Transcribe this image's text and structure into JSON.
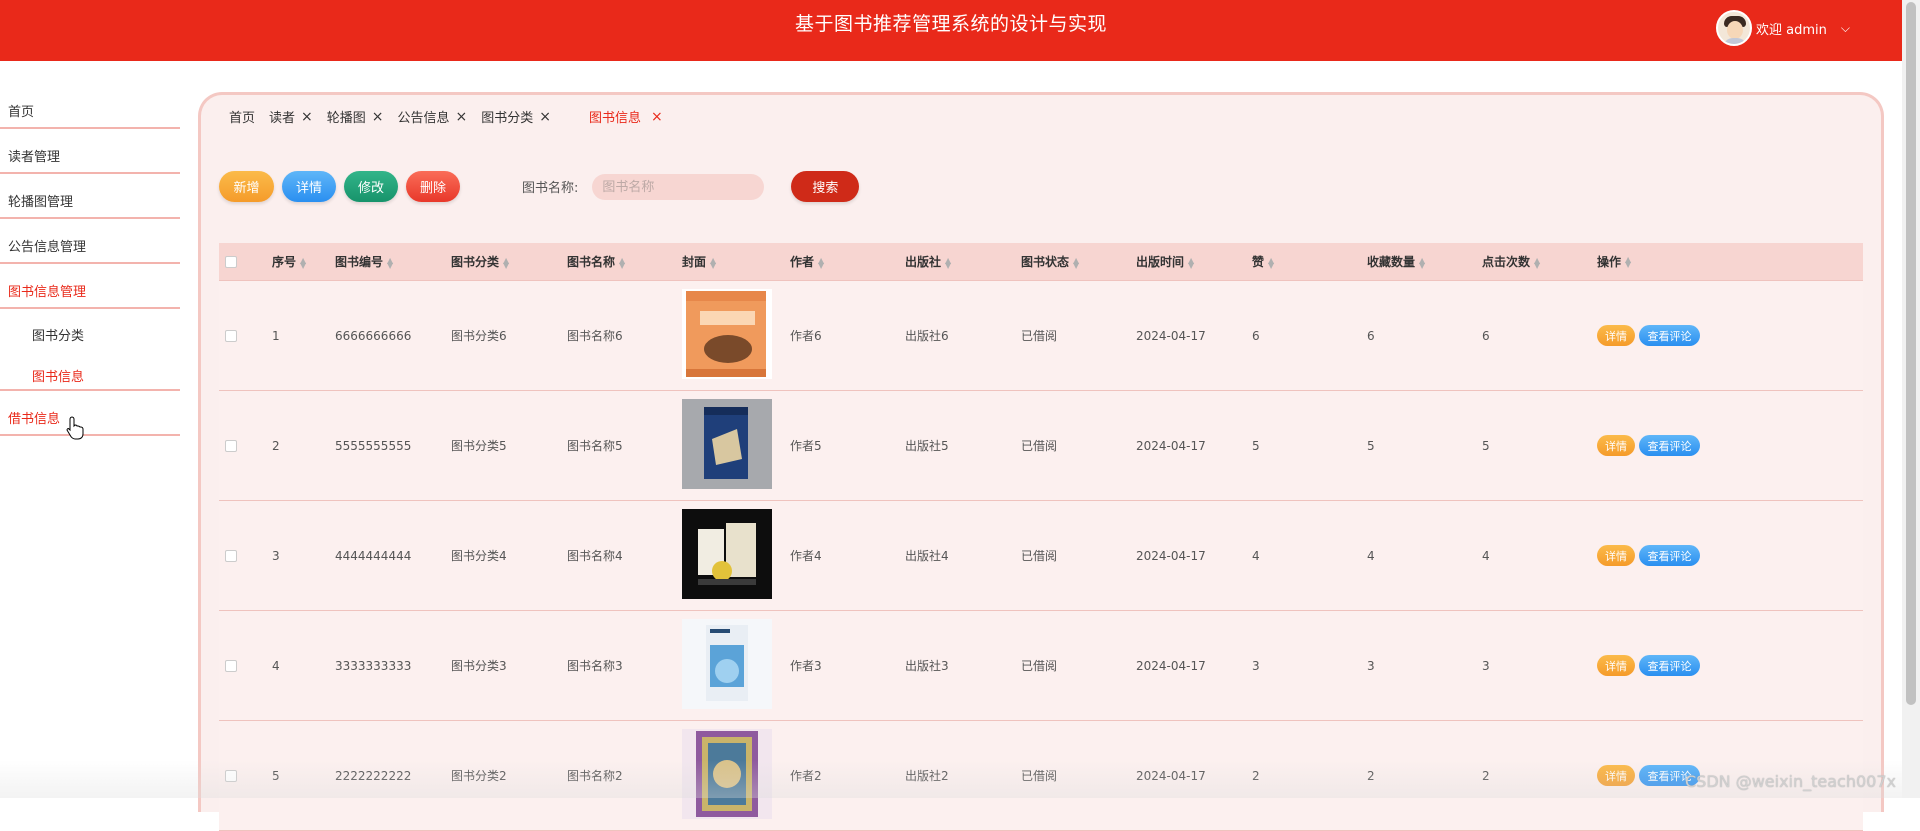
{
  "header": {
    "title": "基于图书推荐管理系统的设计与实现",
    "welcome": "欢迎 admin",
    "avatar_icon": "user-avatar",
    "chevron_icon": "chevron-down-icon"
  },
  "sidebar": {
    "items": [
      {
        "label": "首页"
      },
      {
        "label": "读者管理"
      },
      {
        "label": "轮播图管理"
      },
      {
        "label": "公告信息管理"
      },
      {
        "label": "图书信息管理"
      },
      {
        "label": "借书信息"
      }
    ],
    "subitems": [
      {
        "label": "图书分类"
      },
      {
        "label": "图书信息"
      }
    ]
  },
  "tabs": [
    {
      "label": "首页"
    },
    {
      "label": "读者"
    },
    {
      "label": "轮播图"
    },
    {
      "label": "公告信息"
    },
    {
      "label": "图书分类"
    },
    {
      "label": "图书信息"
    }
  ],
  "tab_close": "×",
  "toolbar": {
    "add": "新增",
    "detail": "详情",
    "edit": "修改",
    "delete": "删除",
    "search_label": "图书名称:",
    "search_placeholder": "图书名称",
    "search": "搜索"
  },
  "table": {
    "headers": [
      "序号",
      "图书编号",
      "图书分类",
      "图书名称",
      "封面",
      "作者",
      "出版社",
      "图书状态",
      "出版时间",
      "赞",
      "收藏数量",
      "点击次数",
      "操作"
    ],
    "rows": [
      {
        "index": "1",
        "code": "6666666666",
        "category": "图书分类6",
        "name": "图书名称6",
        "author": "作者6",
        "publisher": "出版社6",
        "status": "已借阅",
        "date": "2024-04-17",
        "likes": "6",
        "favorites": "6",
        "clicks": "6"
      },
      {
        "index": "2",
        "code": "5555555555",
        "category": "图书分类5",
        "name": "图书名称5",
        "author": "作者5",
        "publisher": "出版社5",
        "status": "已借阅",
        "date": "2024-04-17",
        "likes": "5",
        "favorites": "5",
        "clicks": "5"
      },
      {
        "index": "3",
        "code": "4444444444",
        "category": "图书分类4",
        "name": "图书名称4",
        "author": "作者4",
        "publisher": "出版社4",
        "status": "已借阅",
        "date": "2024-04-17",
        "likes": "4",
        "favorites": "4",
        "clicks": "4"
      },
      {
        "index": "4",
        "code": "3333333333",
        "category": "图书分类3",
        "name": "图书名称3",
        "author": "作者3",
        "publisher": "出版社3",
        "status": "已借阅",
        "date": "2024-04-17",
        "likes": "3",
        "favorites": "3",
        "clicks": "3"
      },
      {
        "index": "5",
        "code": "2222222222",
        "category": "图书分类2",
        "name": "图书名称2",
        "author": "作者2",
        "publisher": "出版社2",
        "status": "已借阅",
        "date": "2024-04-17",
        "likes": "2",
        "favorites": "2",
        "clicks": "2"
      }
    ],
    "row_detail": "详情",
    "row_comment": "查看评论"
  },
  "watermark": "CSDN @weixin_teach007x",
  "colors": {
    "brand": "#e9291a",
    "panel_bg": "#fbefee",
    "header_row": "#f7d5d1"
  }
}
